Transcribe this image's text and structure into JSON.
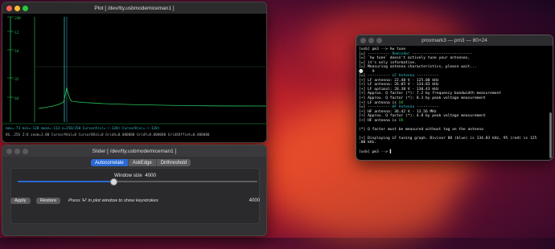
{
  "colors": {
    "accent": "#2b69d4",
    "plot_green": "#27c45a",
    "plot_cyan": "#34b9c6",
    "term_cyan": "#38c1c9",
    "term_green": "#3fbf3f",
    "term_yellow": "#d8c63c"
  },
  "plot_window": {
    "title": "Plot [ /dev/tty.usbmodemiceman1 ]",
    "y_labels": [
      "-240",
      "-12",
      "-16",
      "-32",
      "-64",
      "-96"
    ],
    "status_line_1": "max=-73  min=-128  mean=-113  n=250/250  CursorA(x)=-(-128)  CursorB(x)=-(-128)",
    "status_line_2": "8G..256  Z:0 zoom=1.00  CursorAVal=0  CursorBVal=0  GridX=0.000000  GridY=0.000000  GridXOffset=0.000000"
  },
  "slider_window": {
    "title": "Slider [ /dev/tty.usbmodemiceman1 ]",
    "tabs": [
      "Autocorrelate",
      "AskEdge",
      "Dirthreshold"
    ],
    "active_tab": 0,
    "window_size_label": "Window size",
    "window_size_value": "4000",
    "slider_fraction": 0.4,
    "apply_label": "Apply",
    "restore_label": "Restore",
    "hint": "Press  'H'  in plot window to show keystrokes",
    "bottom_value": "4000"
  },
  "terminal": {
    "title": "proxmark3 — pm3 — 80×24",
    "lines": [
      {
        "segs": [
          {
            "t": "[usb] pm3 --> hw tune",
            "c": "#e8e8e8"
          }
        ]
      },
      {
        "segs": [
          {
            "t": "[=] ---------- ",
            "c": "#e8e8e8"
          },
          {
            "t": "Reminder",
            "c": "#38c1c9"
          },
          {
            "t": " ---------------------------",
            "c": "#e8e8e8"
          }
        ]
      },
      {
        "segs": [
          {
            "t": "[=] `hw tune` doesn't actively tune your antennas,",
            "c": "#e8e8e8"
          }
        ]
      },
      {
        "segs": [
          {
            "t": "[=] it's only informative.",
            "c": "#e8e8e8"
          }
        ]
      },
      {
        "segs": [
          {
            "t": "[=] Measuring antenna characteristics, please wait...",
            "c": "#e8e8e8"
          }
        ]
      },
      {
        "segs": [
          {
            "t": "⚪    9",
            "c": "#e8e8e8"
          }
        ]
      },
      {
        "segs": [
          {
            "t": "[=] ---------- ",
            "c": "#e8e8e8"
          },
          {
            "t": "LF Antenna",
            "c": "#38c1c9"
          },
          {
            "t": " ----------",
            "c": "#e8e8e8"
          }
        ]
      },
      {
        "segs": [
          {
            "t": "[+] LF antenna: 22.48 V - 125.00 kHz",
            "c": "#e8e8e8"
          }
        ]
      },
      {
        "segs": [
          {
            "t": "[+] LF antenna: 26.05 V - 134.83 kHz",
            "c": "#e8e8e8"
          }
        ]
      },
      {
        "segs": [
          {
            "t": "[+] LF optimal: 28.38 V - 130.43 kHz",
            "c": "#e8e8e8"
          }
        ]
      },
      {
        "segs": [
          {
            "t": "[+] Approx. Q factor (*): 7.2 by frequency bandwidth measurement",
            "c": "#e8e8e8"
          }
        ]
      },
      {
        "segs": [
          {
            "t": "[+] Approx. Q factor (*): 8.3 by peak voltage measurement",
            "c": "#e8e8e8"
          }
        ]
      },
      {
        "segs": [
          {
            "t": "[+] LF antenna is ",
            "c": "#e8e8e8"
          },
          {
            "t": "OK",
            "c": "#3fbf3f"
          }
        ]
      },
      {
        "segs": [
          {
            "t": "[=] ---------- ",
            "c": "#e8e8e8"
          },
          {
            "t": "HF Antenna",
            "c": "#38c1c9"
          },
          {
            "t": " ----------",
            "c": "#e8e8e8"
          }
        ]
      },
      {
        "segs": [
          {
            "t": "[+] HF antenna: 36.42 V - 13.56 MHz",
            "c": "#e8e8e8"
          }
        ]
      },
      {
        "segs": [
          {
            "t": "[+] Approx. Q factor (*): 4.8 by peak voltage measurement",
            "c": "#e8e8e8"
          }
        ]
      },
      {
        "segs": [
          {
            "t": "[+] HF antenna is ",
            "c": "#e8e8e8"
          },
          {
            "t": "OK",
            "c": "#3fbf3f"
          }
        ]
      },
      {
        "segs": [
          {
            "t": " ",
            "c": "#e8e8e8"
          }
        ]
      },
      {
        "segs": [
          {
            "t": "(*) Q factor must be measured without tag on the antenna",
            "c": "#e8e8e8"
          }
        ]
      },
      {
        "segs": [
          {
            "t": " ",
            "c": "#e8e8e8"
          }
        ]
      },
      {
        "segs": [
          {
            "t": "[+] Displaying LF tuning graph. Divisor 88 (blue) is 134.83 kHz, 95 (red) is 125",
            "c": "#e8e8e8"
          }
        ]
      },
      {
        "segs": [
          {
            "t": ".00 kHz.",
            "c": "#e8e8e8"
          }
        ]
      },
      {
        "segs": [
          {
            "t": " ",
            "c": "#e8e8e8"
          }
        ]
      },
      {
        "segs": [
          {
            "t": "[usb] pm3 --> ",
            "c": "#e8e8e8"
          },
          {
            "t": "▌",
            "c": "#d0d0d0"
          }
        ]
      }
    ]
  }
}
